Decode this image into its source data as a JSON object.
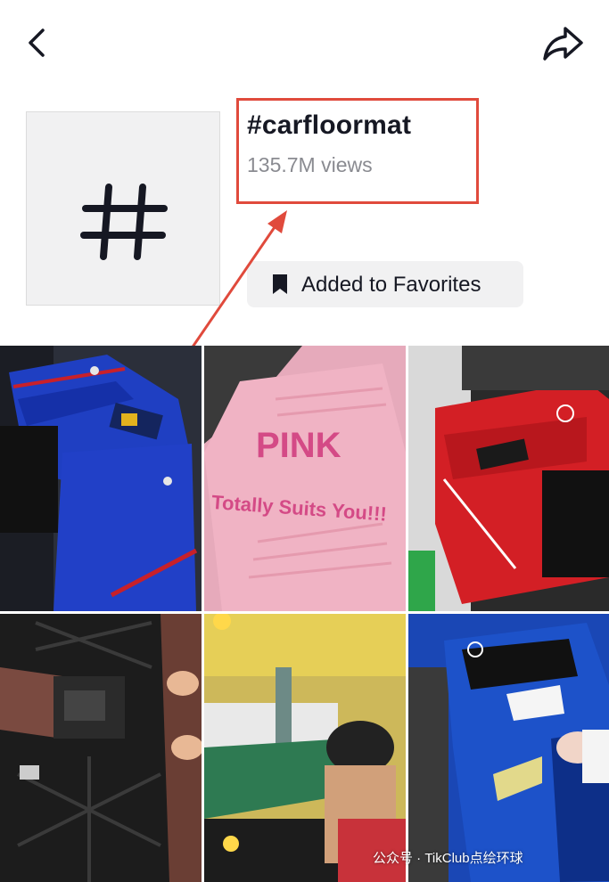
{
  "header": {
    "back_icon": "chevron-left-icon",
    "share_icon": "share-arrow-icon"
  },
  "hashtag": {
    "symbol_icon": "hash-icon",
    "title": "#carfloormat",
    "views": "135.7M views"
  },
  "favorites": {
    "icon": "bookmark-icon",
    "label": "Added to Favorites"
  },
  "videos": [
    {
      "id": "video-1",
      "overlay": ""
    },
    {
      "id": "video-2",
      "overlay_line1": "PINK",
      "overlay_line2": "Totally Suits You!!!"
    },
    {
      "id": "video-3",
      "overlay": ""
    },
    {
      "id": "video-4",
      "overlay": ""
    },
    {
      "id": "video-5",
      "overlay": ""
    },
    {
      "id": "video-6",
      "overlay": ""
    }
  ],
  "watermark": "公众号 · TikClub点绘环球",
  "colors": {
    "highlight_box": "#e04a3c",
    "accent_pink": "#d44a86"
  }
}
